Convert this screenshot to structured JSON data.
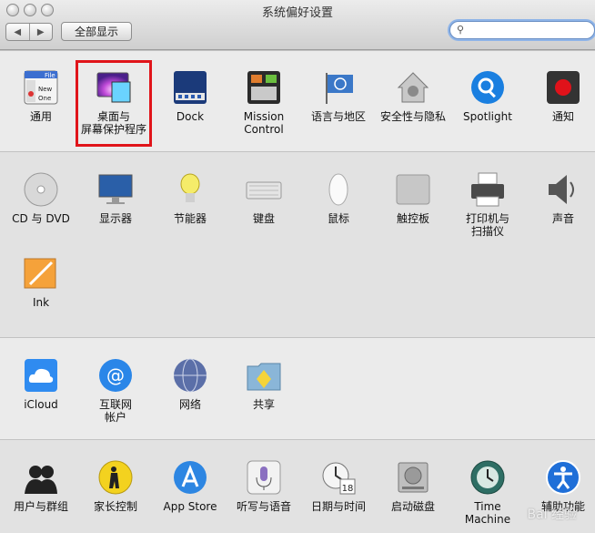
{
  "window": {
    "title": "系统偏好设置"
  },
  "toolbar": {
    "back": "◀",
    "forward": "▶",
    "show_all": "全部显示",
    "search_placeholder": ""
  },
  "sections": {
    "personal": [
      {
        "label": "通用",
        "icon": "general-icon"
      },
      {
        "label": "桌面与\n屏幕保护程序",
        "icon": "desktop-screensaver-icon"
      },
      {
        "label": "Dock",
        "icon": "dock-icon"
      },
      {
        "label": "Mission\nControl",
        "icon": "mission-control-icon"
      },
      {
        "label": "语言与地区",
        "icon": "language-region-icon"
      },
      {
        "label": "安全性与隐私",
        "icon": "security-privacy-icon"
      },
      {
        "label": "Spotlight",
        "icon": "spotlight-icon"
      },
      {
        "label": "通知",
        "icon": "notifications-icon"
      }
    ],
    "hardware": [
      {
        "label": "CD 与 DVD",
        "icon": "cd-dvd-icon"
      },
      {
        "label": "显示器",
        "icon": "displays-icon"
      },
      {
        "label": "节能器",
        "icon": "energy-saver-icon"
      },
      {
        "label": "键盘",
        "icon": "keyboard-icon"
      },
      {
        "label": "鼠标",
        "icon": "mouse-icon"
      },
      {
        "label": "触控板",
        "icon": "trackpad-icon"
      },
      {
        "label": "打印机与\n扫描仪",
        "icon": "printers-scanners-icon"
      },
      {
        "label": "声音",
        "icon": "sound-icon"
      },
      {
        "label": "Ink",
        "icon": "ink-icon"
      }
    ],
    "internet": [
      {
        "label": "iCloud",
        "icon": "icloud-icon"
      },
      {
        "label": "互联网\n帐户",
        "icon": "internet-accounts-icon"
      },
      {
        "label": "网络",
        "icon": "network-icon"
      },
      {
        "label": "共享",
        "icon": "sharing-icon"
      }
    ],
    "system": [
      {
        "label": "用户与群组",
        "icon": "users-groups-icon"
      },
      {
        "label": "家长控制",
        "icon": "parental-controls-icon"
      },
      {
        "label": "App Store",
        "icon": "app-store-icon"
      },
      {
        "label": "听写与语音",
        "icon": "dictation-speech-icon"
      },
      {
        "label": "日期与时间",
        "icon": "date-time-icon"
      },
      {
        "label": "启动磁盘",
        "icon": "startup-disk-icon"
      },
      {
        "label": "Time Machine",
        "icon": "time-machine-icon"
      },
      {
        "label": "辅助功能",
        "icon": "accessibility-icon"
      }
    ]
  },
  "icon_text": {
    "file": "File",
    "new": "New",
    "one": "One",
    "date": "18"
  },
  "watermark": "Bai 经验"
}
